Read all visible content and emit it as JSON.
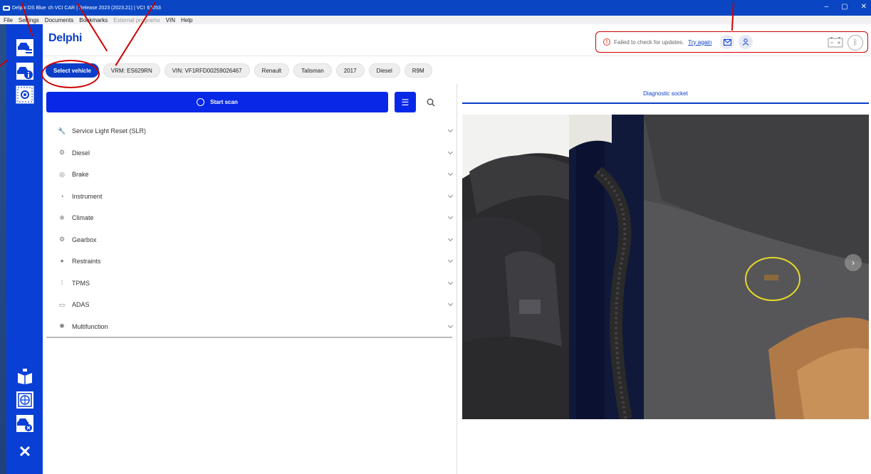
{
  "window": {
    "title": "Delphi DS Blue",
    "title_tail": "ch VCI CAR | Release 2023 (2023.21) | VCI",
    "title_end": "61053",
    "min": "–",
    "max": "▢",
    "close": "✕"
  },
  "menu": {
    "file": "File",
    "settings": "Settings",
    "documents": "Documents",
    "bookmarks": "Bookmarks",
    "external": "External programs",
    "vin": "VIN",
    "help": "Help"
  },
  "logo": "Delphi",
  "status": {
    "message": "Failed to check for updates.",
    "try_again": "Try again"
  },
  "chips": [
    "Select vehicle",
    "VRM: ES629RN",
    "VIN: VF1RFD00259026467",
    "Renault",
    "Talisman",
    "2017",
    "Diesel",
    "R9M"
  ],
  "scan": {
    "label": "Start scan"
  },
  "systems": [
    {
      "label": "Service Light Reset (SLR)",
      "icon": "wrench-icon"
    },
    {
      "label": "Diesel",
      "icon": "engine-icon"
    },
    {
      "label": "Brake",
      "icon": "brake-icon"
    },
    {
      "label": "Instrument",
      "icon": "gauge-icon"
    },
    {
      "label": "Climate",
      "icon": "snowflake-icon"
    },
    {
      "label": "Gearbox",
      "icon": "gears-icon"
    },
    {
      "label": "Restraints",
      "icon": "airbag-icon"
    },
    {
      "label": "TPMS",
      "icon": "tyre-pressure-icon"
    },
    {
      "label": "ADAS",
      "icon": "adas-icon"
    },
    {
      "label": "Multifunction",
      "icon": "multifunction-icon"
    }
  ],
  "right_panel": {
    "tab": "Diagnostic socket"
  },
  "colors": {
    "brand_blue": "#0b3ec7",
    "scan_blue": "#0828e8",
    "annotation_red": "#cc0000"
  }
}
